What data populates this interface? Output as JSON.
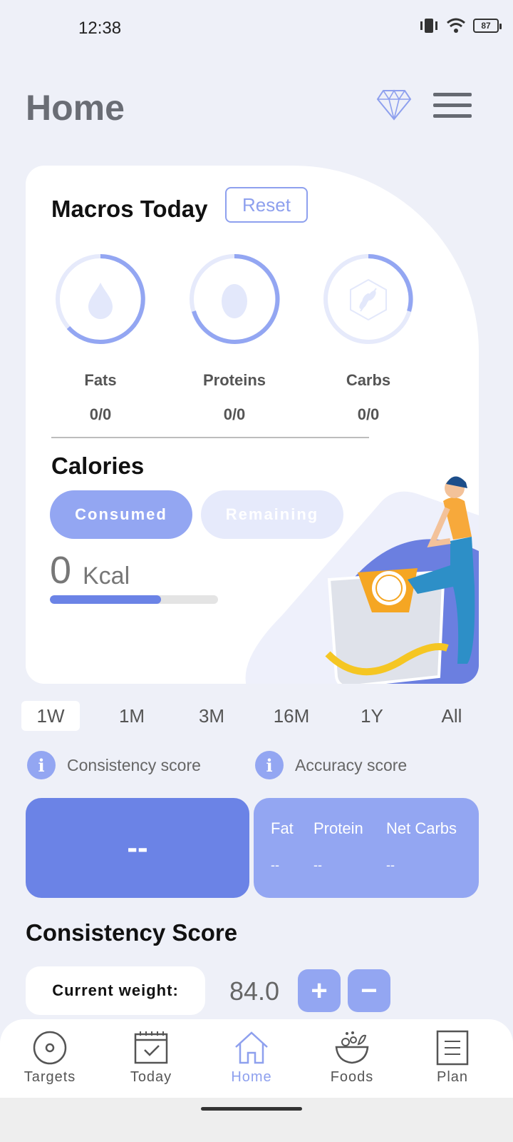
{
  "status": {
    "time": "12:38",
    "battery": "87"
  },
  "header": {
    "title": "Home"
  },
  "macros": {
    "title": "Macros Today",
    "reset_label": "Reset",
    "items": [
      {
        "name": "Fats",
        "value": "0/0",
        "icon": "drop-icon"
      },
      {
        "name": "Proteins",
        "value": "0/0",
        "icon": "egg-icon"
      },
      {
        "name": "Carbs",
        "value": "0/0",
        "icon": "wheat-icon"
      }
    ]
  },
  "calories": {
    "title": "Calories",
    "consumed_label": "Consumed",
    "remaining_label": "Remaining",
    "value": "0",
    "unit": "Kcal",
    "progress": 0.66
  },
  "periods": [
    "1W",
    "1M",
    "3M",
    "16M",
    "1Y",
    "All"
  ],
  "scores": {
    "consistency_label": "Consistency score",
    "accuracy_label": "Accuracy score",
    "consistency_value": "--",
    "fat_label": "Fat",
    "protein_label": "Protein",
    "net_carbs_label": "Net Carbs",
    "fat_value": "--",
    "protein_value": "--",
    "net_carbs_value": "--"
  },
  "consistency": {
    "title": "Consistency Score",
    "weight_label": "Current weight:",
    "weight_value": "84.0",
    "plus": "+",
    "minus": "−"
  },
  "nav": {
    "targets": "Targets",
    "today": "Today",
    "home": "Home",
    "foods": "Foods",
    "plan": "Plan"
  },
  "colors": {
    "accent": "#6b83e6",
    "accent_light": "#93a6f2",
    "pale": "#e6eafb"
  }
}
